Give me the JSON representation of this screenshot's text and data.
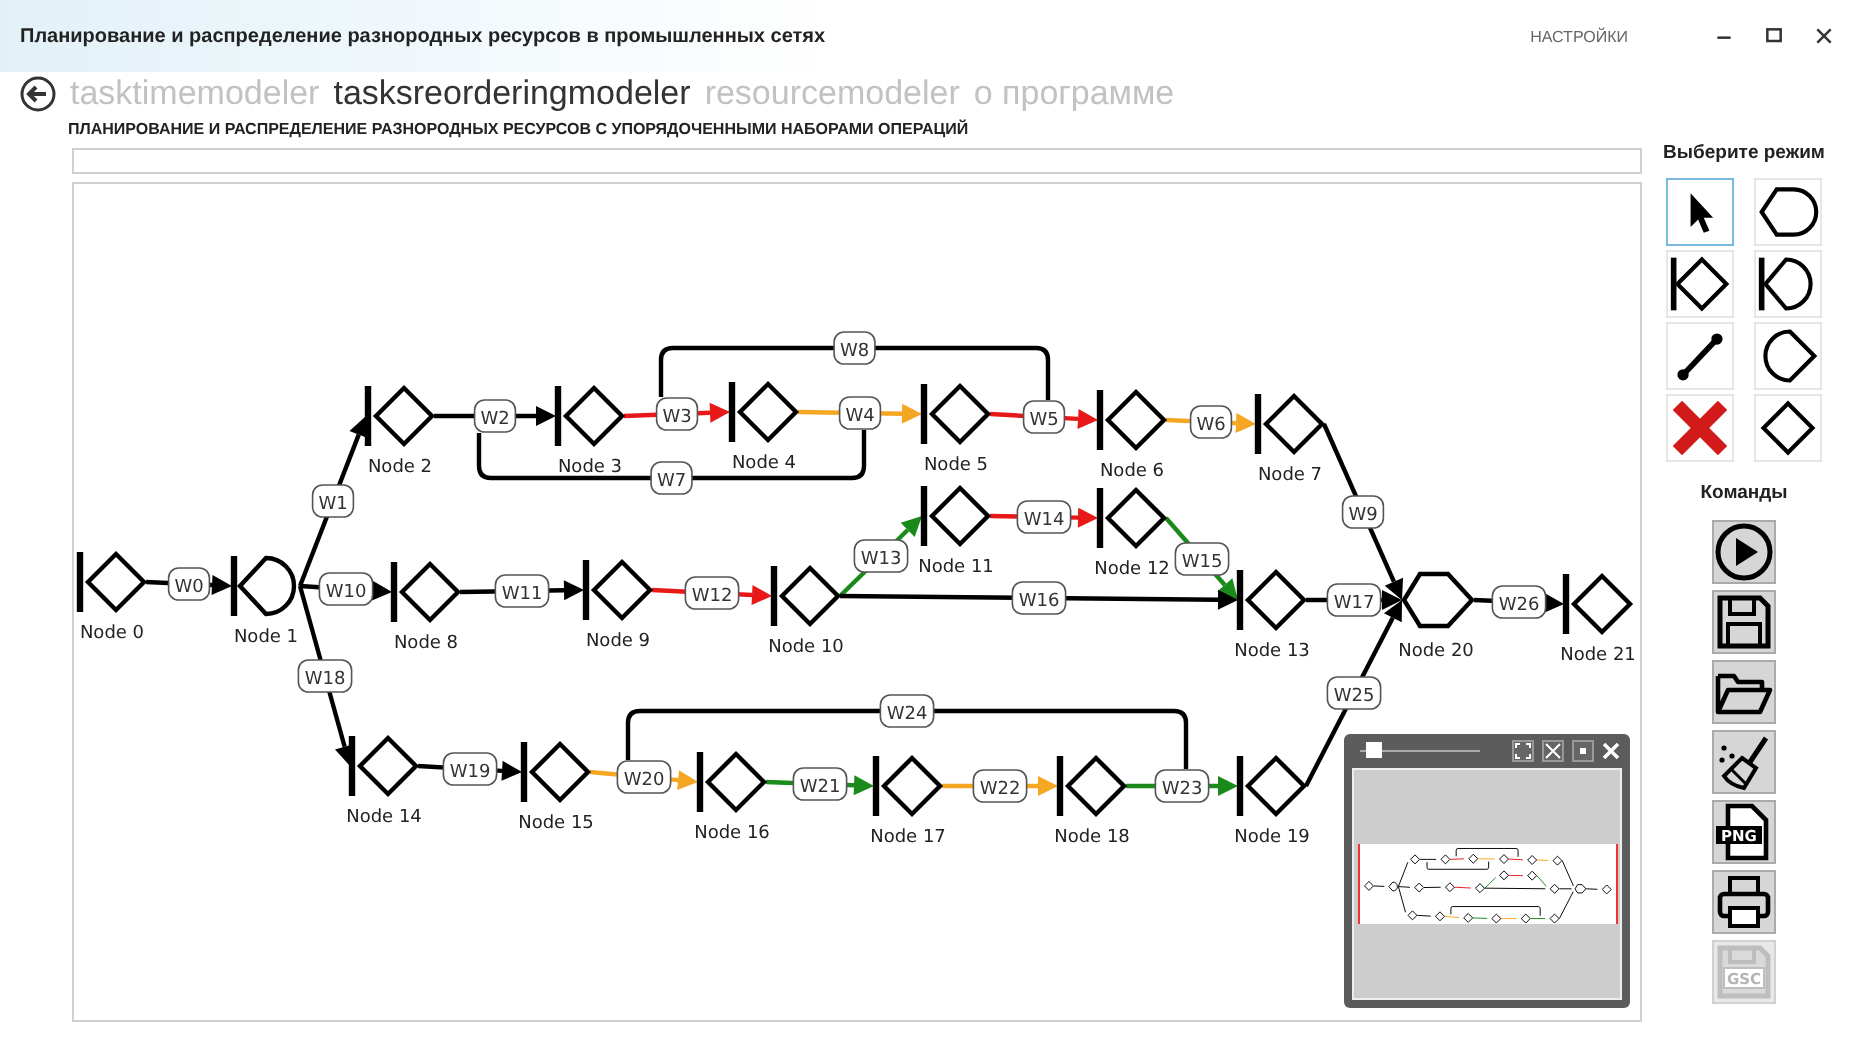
{
  "window": {
    "title": "Планирование и распределение разнородных ресурсов в промышленных сетях",
    "settings": "НАСТРОЙКИ"
  },
  "tabs": [
    {
      "label": "tasktimemodeler",
      "selected": false
    },
    {
      "label": "tasksreorderingmodeler",
      "selected": true
    },
    {
      "label": "resourcemodeler",
      "selected": false
    },
    {
      "label": "о программе",
      "selected": false
    }
  ],
  "subtitle": "ПЛАНИРОВАНИЕ И РАСПРЕДЕЛЕНИЕ РАЗНОРОДНЫХ РЕСУРСОВ С УПОРЯДОЧЕННЫМИ НАБОРАМИ ОПЕРАЦИЙ",
  "diagram": {
    "nodes": [
      {
        "label": "Node 0",
        "kind": "bar-diamond"
      },
      {
        "label": "Node 1",
        "kind": "bar-round"
      },
      {
        "label": "Node 2",
        "kind": "bar-diamond"
      },
      {
        "label": "Node 3",
        "kind": "bar-diamond"
      },
      {
        "label": "Node 4",
        "kind": "bar-diamond"
      },
      {
        "label": "Node 5",
        "kind": "bar-diamond"
      },
      {
        "label": "Node 6",
        "kind": "bar-diamond"
      },
      {
        "label": "Node 7",
        "kind": "bar-diamond"
      },
      {
        "label": "Node 8",
        "kind": "bar-diamond"
      },
      {
        "label": "Node 9",
        "kind": "bar-diamond"
      },
      {
        "label": "Node 10",
        "kind": "bar-diamond"
      },
      {
        "label": "Node 11",
        "kind": "bar-diamond"
      },
      {
        "label": "Node 12",
        "kind": "bar-diamond"
      },
      {
        "label": "Node 13",
        "kind": "bar-diamond"
      },
      {
        "label": "Node 14",
        "kind": "bar-diamond"
      },
      {
        "label": "Node 15",
        "kind": "bar-diamond"
      },
      {
        "label": "Node 16",
        "kind": "bar-diamond"
      },
      {
        "label": "Node 17",
        "kind": "bar-diamond"
      },
      {
        "label": "Node 18",
        "kind": "bar-diamond"
      },
      {
        "label": "Node 19",
        "kind": "bar-diamond"
      },
      {
        "label": "Node 20",
        "kind": "merge"
      },
      {
        "label": "Node 21",
        "kind": "bar-diamond"
      }
    ],
    "edges": [
      {
        "label": "W0",
        "kind": "flow",
        "color": "#000000"
      },
      {
        "label": "W1",
        "kind": "flow",
        "color": "#000000"
      },
      {
        "label": "W2",
        "kind": "flow",
        "color": "#000000"
      },
      {
        "label": "W3",
        "kind": "flow",
        "color": "#e81818"
      },
      {
        "label": "W4",
        "kind": "flow",
        "color": "#f5a623"
      },
      {
        "label": "W5",
        "kind": "flow",
        "color": "#e81818"
      },
      {
        "label": "W6",
        "kind": "flow",
        "color": "#f5a623"
      },
      {
        "label": "W7",
        "kind": "link",
        "color": "#000000"
      },
      {
        "label": "W8",
        "kind": "link",
        "color": "#000000"
      },
      {
        "label": "W9",
        "kind": "flow",
        "color": "#000000"
      },
      {
        "label": "W10",
        "kind": "flow",
        "color": "#000000"
      },
      {
        "label": "W11",
        "kind": "flow",
        "color": "#000000"
      },
      {
        "label": "W12",
        "kind": "flow",
        "color": "#e81818"
      },
      {
        "label": "W13",
        "kind": "flow",
        "color": "#1a8a1a"
      },
      {
        "label": "W14",
        "kind": "flow",
        "color": "#e81818"
      },
      {
        "label": "W15",
        "kind": "flow",
        "color": "#1a8a1a"
      },
      {
        "label": "W16",
        "kind": "flow",
        "color": "#000000"
      },
      {
        "label": "W17",
        "kind": "flow",
        "color": "#000000"
      },
      {
        "label": "W18",
        "kind": "flow",
        "color": "#000000"
      },
      {
        "label": "W19",
        "kind": "flow",
        "color": "#000000"
      },
      {
        "label": "W20",
        "kind": "flow",
        "color": "#f5a623"
      },
      {
        "label": "W21",
        "kind": "flow",
        "color": "#1a8a1a"
      },
      {
        "label": "W22",
        "kind": "flow",
        "color": "#f5a623"
      },
      {
        "label": "W23",
        "kind": "flow",
        "color": "#1a8a1a"
      },
      {
        "label": "W24",
        "kind": "link",
        "color": "#000000"
      },
      {
        "label": "W25",
        "kind": "flow",
        "color": "#000000"
      },
      {
        "label": "W26",
        "kind": "flow",
        "color": "#000000"
      }
    ]
  },
  "minimap": {
    "zoom": {
      "level": 0.05
    }
  },
  "modes": {
    "title": "Выберите режим",
    "items": [
      {
        "kind": "pointer",
        "selected": true
      },
      {
        "kind": "merge",
        "selected": false
      },
      {
        "kind": "bar-diamond",
        "selected": false
      },
      {
        "kind": "bar-round",
        "selected": false
      },
      {
        "kind": "connector",
        "selected": false
      },
      {
        "kind": "split",
        "selected": false
      },
      {
        "kind": "delete",
        "selected": false
      },
      {
        "kind": "diamond",
        "selected": false
      }
    ]
  },
  "commands": {
    "title": "Команды",
    "items": [
      {
        "kind": "run",
        "disabled": false
      },
      {
        "kind": "save",
        "disabled": false
      },
      {
        "kind": "open",
        "disabled": false
      },
      {
        "kind": "clear",
        "disabled": false
      },
      {
        "kind": "export-png",
        "text": "PNG",
        "disabled": false
      },
      {
        "kind": "print",
        "disabled": false
      },
      {
        "kind": "save-gsc",
        "text": "GSC",
        "disabled": true
      }
    ]
  }
}
